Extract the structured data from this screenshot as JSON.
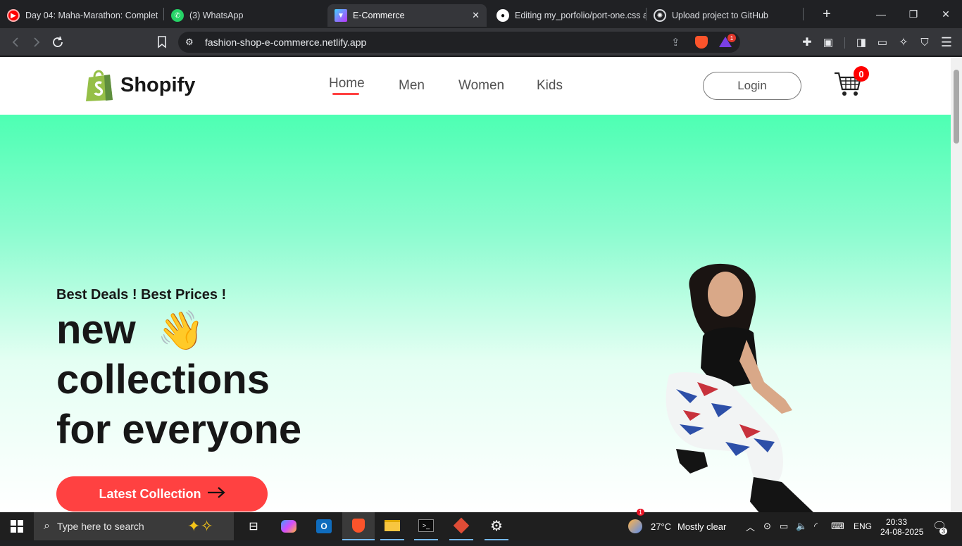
{
  "browser": {
    "tabs": [
      {
        "title": "Day 04: Maha-Marathon: Complet",
        "icon": "youtube-icon",
        "color": "#ff0000"
      },
      {
        "title": "(3) WhatsApp",
        "icon": "whatsapp-icon",
        "color": "#25d366"
      },
      {
        "title": "E-Commerce",
        "icon": "vite-icon",
        "color": "#8f6cff",
        "active": true
      },
      {
        "title": "Editing my_porfolio/port-one.css a",
        "icon": "github-icon",
        "color": "#ffffff"
      },
      {
        "title": "Upload project to GitHub",
        "icon": "chatgpt-icon",
        "color": "#ffffff"
      }
    ],
    "new_tab_label": "+",
    "url": "fashion-shop-e-commerce.netlify.app",
    "brave_badge": "1"
  },
  "site": {
    "brand": "Shopify",
    "nav": [
      "Home",
      "Men",
      "Women",
      "Kids"
    ],
    "active_nav": "Home",
    "login_label": "Login",
    "cart_count": "0",
    "accent_color": "#ff4141"
  },
  "hero": {
    "subtitle": "Best Deals ! Best Prices !",
    "line1": "new",
    "line2": "collections",
    "line3": "for everyone",
    "emoji": "👋",
    "cta_label": "Latest Collection"
  },
  "taskbar": {
    "search_placeholder": "Type here to search",
    "temperature": "27°C",
    "weather": "Mostly clear",
    "weather_badge": "1",
    "language": "ENG",
    "time": "20:33",
    "date": "24-08-2025",
    "notification_count": "3"
  }
}
